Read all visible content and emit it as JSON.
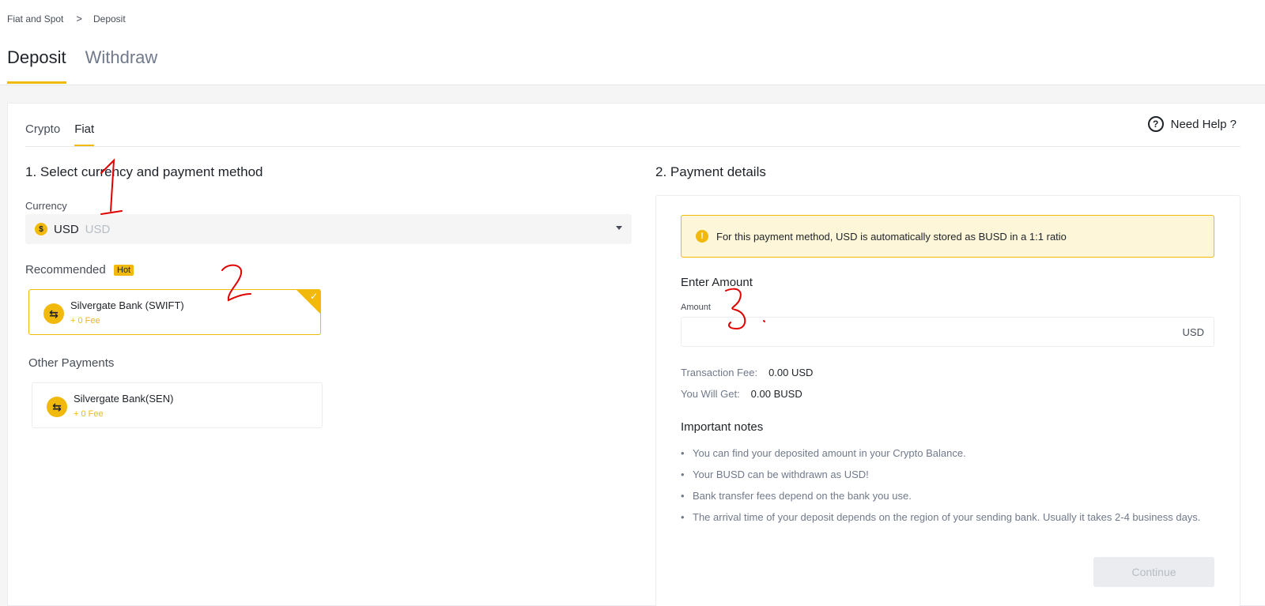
{
  "breadcrumb": {
    "parent": "Fiat and Spot",
    "separator": ">",
    "current": "Deposit"
  },
  "main_tabs": [
    {
      "label": "Deposit",
      "active": true
    },
    {
      "label": "Withdraw",
      "active": false
    }
  ],
  "sub_tabs": [
    {
      "label": "Crypto",
      "active": false
    },
    {
      "label": "Fiat",
      "active": true
    }
  ],
  "help": {
    "label": "Need Help ?",
    "icon": "question-circle-icon"
  },
  "left": {
    "title": "1. Select currency and payment method",
    "currency_label": "Currency",
    "currency": {
      "code": "USD",
      "name": "USD",
      "icon": "dollar-coin-icon"
    },
    "recommended_label": "Recommended",
    "hot_badge": "Hot",
    "recommended_method": {
      "name": "Silvergate Bank (SWIFT)",
      "fee": "+ 0 Fee",
      "selected": true
    },
    "other_label": "Other Payments",
    "other_method": {
      "name": "Silvergate Bank(SEN)",
      "fee": "+ 0 Fee",
      "selected": false
    }
  },
  "right": {
    "title": "2. Payment details",
    "notice": "For this payment method, USD is automatically stored as BUSD in a 1:1 ratio",
    "enter_amount_title": "Enter Amount",
    "amount_label": "Amount",
    "amount_value": "",
    "amount_unit": "USD",
    "transaction_fee_label": "Transaction Fee:",
    "transaction_fee_value": "0.00 USD",
    "you_get_label": "You Will Get:",
    "you_get_value": "0.00 BUSD",
    "notes_title": "Important notes",
    "notes": [
      "You can find your deposited amount in your Crypto Balance.",
      "Your BUSD can be withdrawn as USD!",
      "Bank transfer fees depend on the bank you use.",
      "The arrival time of your deposit depends on the region of your sending bank. Usually it takes 2-4 business days."
    ],
    "continue_label": "Continue"
  },
  "annotations": [
    "1",
    "2",
    "3"
  ],
  "colors": {
    "accent": "#f0b90b",
    "annotation": "#e00000",
    "text": "#1e2329",
    "muted": "#707a8a"
  }
}
